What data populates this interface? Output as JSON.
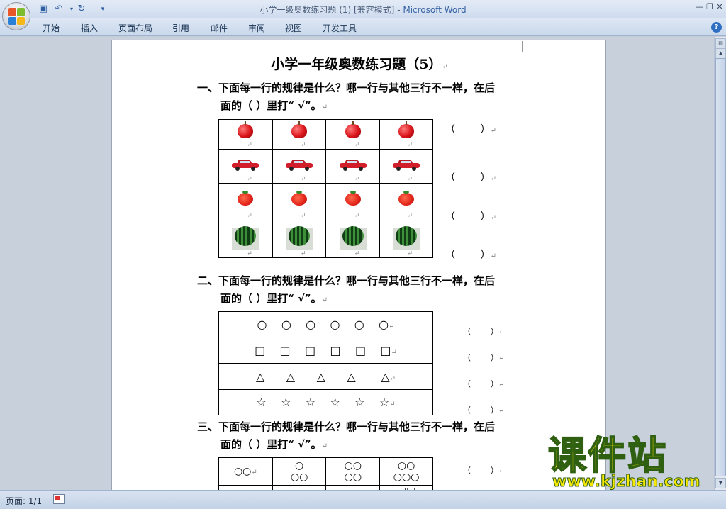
{
  "window": {
    "title": "小学一级奥数练习题 (1) [兼容模式]",
    "app_name": "Microsoft Word",
    "separator": " - "
  },
  "ribbon": {
    "tabs": [
      "开始",
      "插入",
      "页面布局",
      "引用",
      "邮件",
      "审阅",
      "视图",
      "开发工具"
    ]
  },
  "document": {
    "title": "小学一年级奥数练习题（5）",
    "q1": {
      "line1": "一、下面每一行的规律是什么？哪一行与其他三行不一样，在后",
      "line2": "面的（      ）里打“ √”。"
    },
    "q2": {
      "line1": "二、下面每一行的规律是什么？哪一行与其他三行不一样，在后",
      "line2": "面的（      ）里打“ √”。"
    },
    "q3": {
      "line1": "三、下面每一行的规律是什么？哪一行与其他三行不一样，在后",
      "line2": "面的（      ）里打“ √”。"
    },
    "paren": "（        ）",
    "return_mark": "↵",
    "picture_rows": [
      "apple",
      "car",
      "tomato",
      "watermelon"
    ],
    "shape_rows": [
      [
        "○",
        "○",
        "○",
        "○",
        "○",
        "○"
      ],
      [
        "□",
        "□",
        "□",
        "□",
        "□",
        "□"
      ],
      [
        "△",
        "△",
        "△",
        "△",
        "△"
      ],
      [
        "☆",
        "☆",
        "☆",
        "☆",
        "☆",
        "☆"
      ]
    ],
    "q3_row1": [
      [
        "○○"
      ],
      [
        "○",
        "○○"
      ],
      [
        "○○",
        "○○"
      ],
      [
        "○○",
        "○○○"
      ]
    ],
    "q3_row2_last": "□□"
  },
  "statusbar": {
    "page": "页面: 1/1"
  },
  "watermark": {
    "cn": "课件站",
    "url": "www.kjzhan.com"
  },
  "colors": {
    "accent": "#3561a3",
    "watermark": "#f6e800"
  }
}
